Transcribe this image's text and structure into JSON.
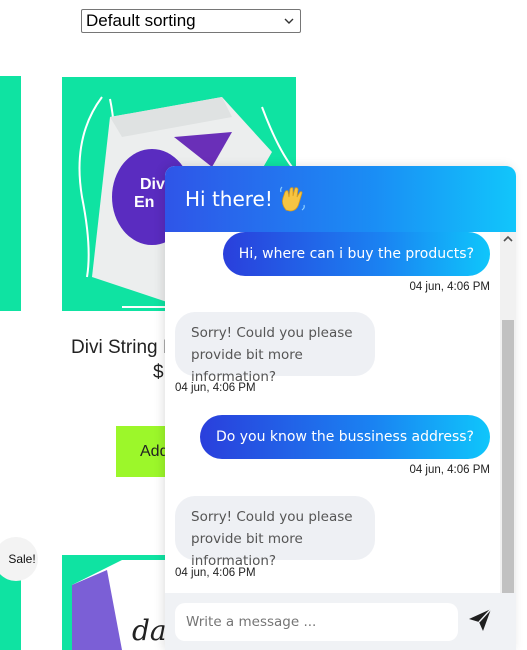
{
  "shop": {
    "sort_select": {
      "value": "Default sorting"
    },
    "product": {
      "title": "Divi String I",
      "price": "$",
      "add_button": "Add",
      "image_text": "Divi En"
    },
    "sale_badge": "Sale!"
  },
  "chat": {
    "header_title": "Hi there!",
    "header_icon": "waving-hand-icon",
    "messages": [
      {
        "sender": "user",
        "text": "Hi, where can i buy the products?",
        "time": "04 jun, 4:06 PM"
      },
      {
        "sender": "bot",
        "text": "Sorry! Could you please provide bit more information?",
        "time": "04 jun, 4:06 PM"
      },
      {
        "sender": "user",
        "text": "Do you know the bussiness address?",
        "time": "04 jun, 4:06 PM"
      },
      {
        "sender": "bot",
        "text": "Sorry! Could you please provide bit more information?",
        "time": "04 jun, 4:06 PM"
      }
    ],
    "input": {
      "placeholder": "Write a message ..."
    },
    "send_icon": "send-icon"
  },
  "colors": {
    "product_bg": "#0fe3a2",
    "add_button_bg": "#9cf72a",
    "header_gradient_start": "#2f55e8",
    "header_gradient_end": "#11c6fb",
    "bot_bubble": "#eef0f4"
  }
}
